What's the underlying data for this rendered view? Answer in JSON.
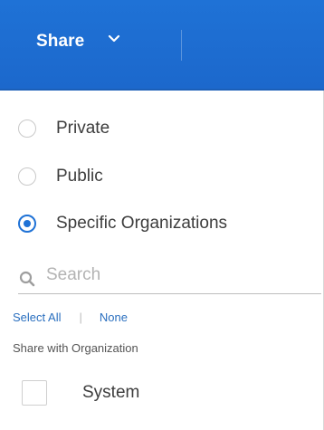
{
  "header": {
    "share_label": "Share",
    "chevron_icon": "chevron-down-icon",
    "background_color": "#1f72d6"
  },
  "visibility": {
    "options": [
      {
        "label": "Private",
        "checked": false
      },
      {
        "label": "Public",
        "checked": false
      },
      {
        "label": "Specific Organizations",
        "checked": true
      }
    ]
  },
  "search": {
    "placeholder": "Search",
    "value": "",
    "icon": "search-icon"
  },
  "selection_links": {
    "select_all": "Select All",
    "separator": "|",
    "none": "None"
  },
  "organizations": {
    "heading": "Share with Organization",
    "items": [
      {
        "label": "System",
        "checked": false
      }
    ]
  },
  "colors": {
    "accent": "#1f72d6",
    "link": "#2a6fbf"
  }
}
